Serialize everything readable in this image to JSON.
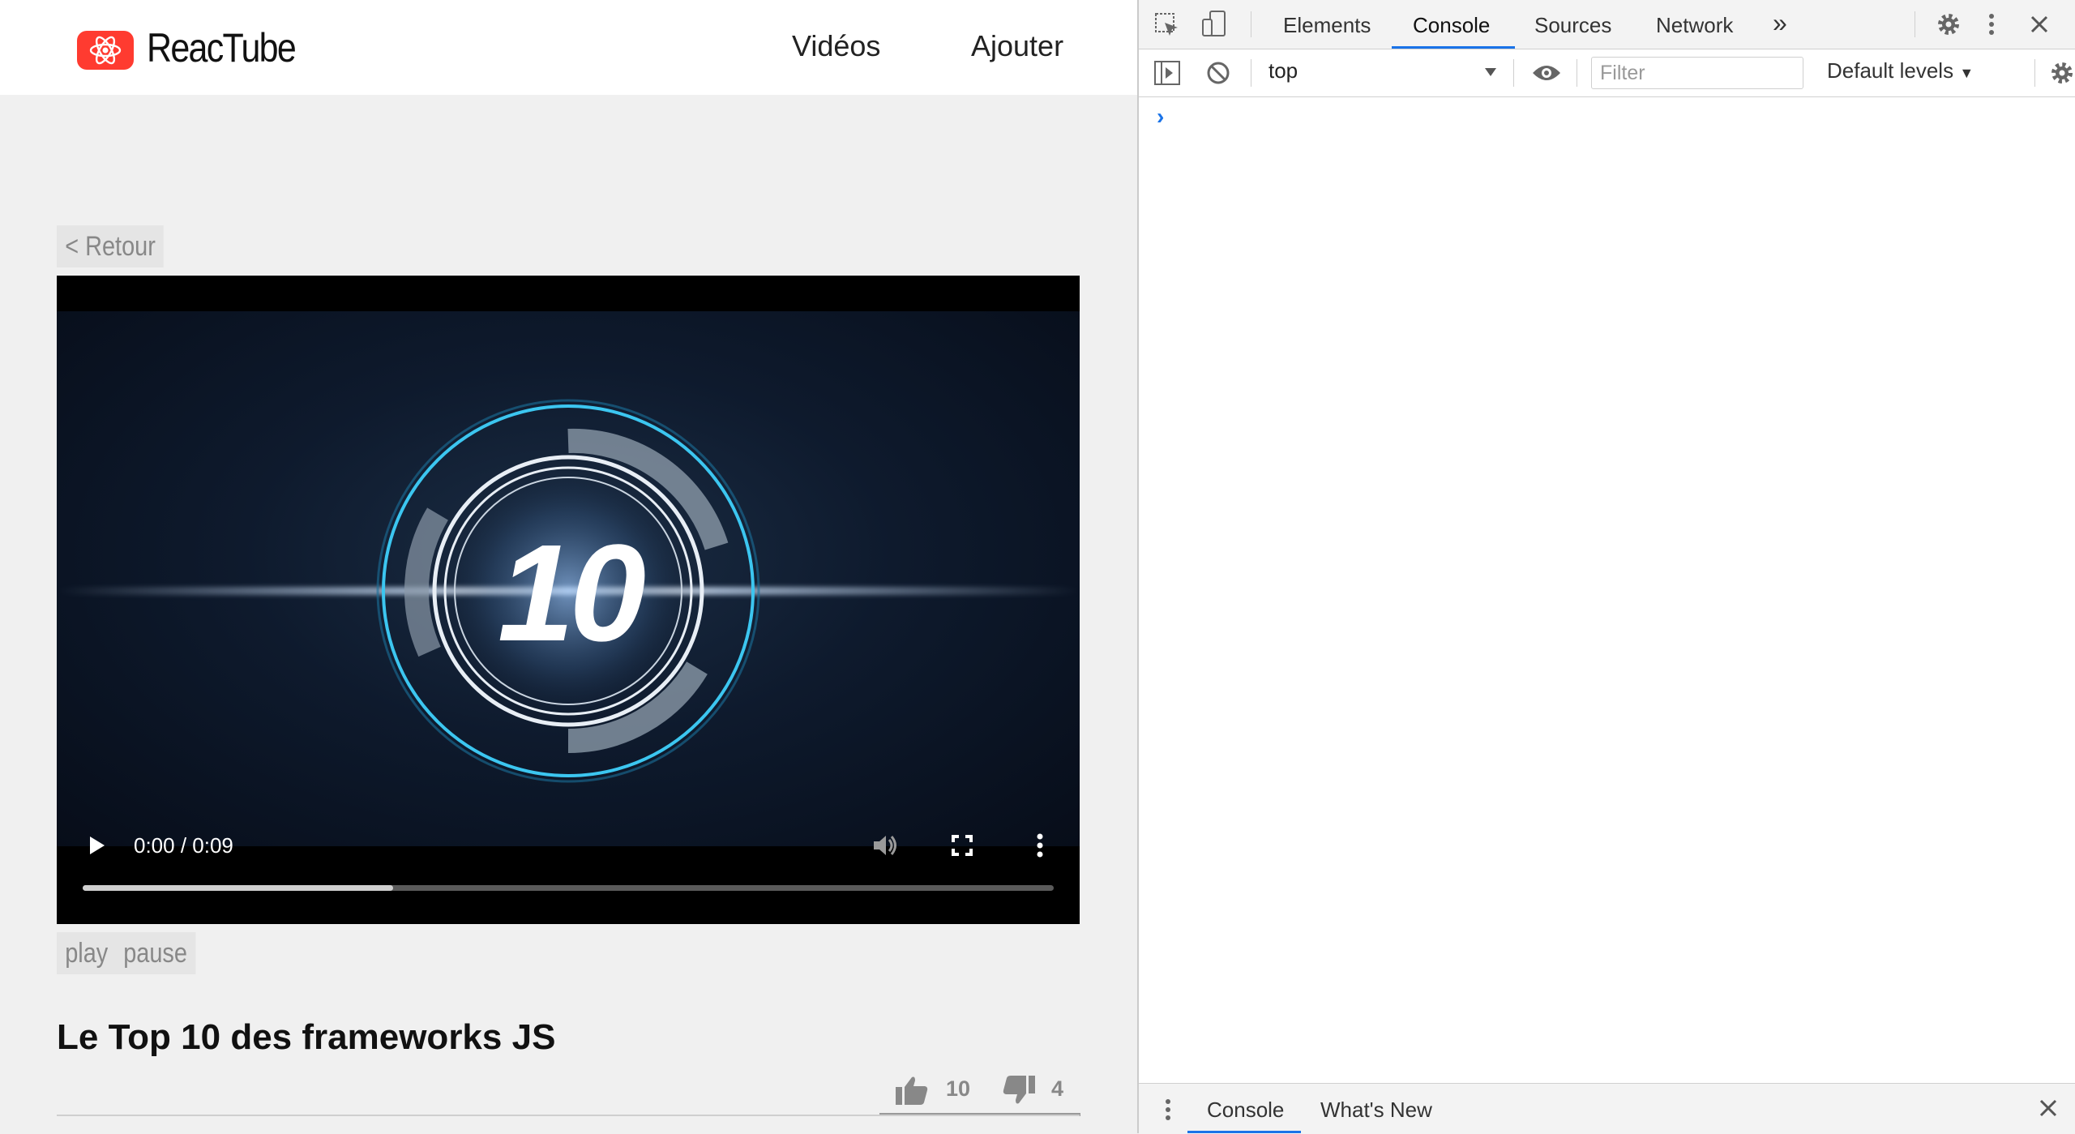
{
  "app": {
    "brand": "ReacTube",
    "nav": [
      "Vidéos",
      "Ajouter"
    ],
    "back_label": "< Retour",
    "video": {
      "overlay_text": "10",
      "time": "0:00 / 0:09",
      "progress_fraction": 0.32
    },
    "buttons": {
      "play": "play",
      "pause": "pause"
    },
    "title": "Le Top 10 des frameworks JS",
    "likes": "10",
    "dislikes": "4",
    "colors": {
      "brand": "#ff3b30",
      "accent": "#1a73e8"
    }
  },
  "devtools": {
    "tabs": [
      "Elements",
      "Console",
      "Sources",
      "Network"
    ],
    "active_tab": "Console",
    "more_tabs": "»",
    "context": "top",
    "filter_placeholder": "Filter",
    "levels": "Default levels",
    "prompt": "›",
    "drawer_tabs": [
      "Console",
      "What's New"
    ]
  }
}
